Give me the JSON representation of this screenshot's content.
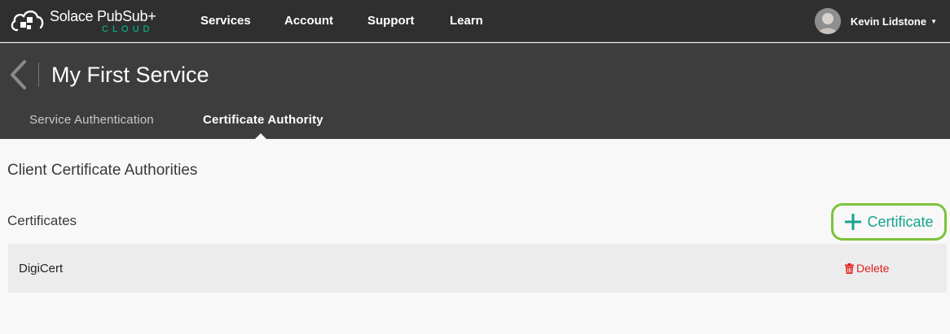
{
  "brand": {
    "name": "Solace PubSub+",
    "sub": "CLOUD",
    "logo_icon": "solace-cloud-logo-icon"
  },
  "nav": {
    "items": [
      {
        "label": "Services"
      },
      {
        "label": "Account"
      },
      {
        "label": "Support"
      },
      {
        "label": "Learn"
      }
    ],
    "user": {
      "name": "Kevin Lidstone",
      "avatar_icon": "user-avatar-icon",
      "caret_icon": "caret-down-icon"
    }
  },
  "service": {
    "title": "My First Service",
    "back_icon": "chevron-left-icon",
    "tabs": [
      {
        "label": "Service Authentication",
        "active": false
      },
      {
        "label": "Certificate Authority",
        "active": true
      }
    ]
  },
  "content": {
    "section_title": "Client Certificate Authorities",
    "certificates_title": "Certificates",
    "add_button": {
      "label": "Certificate",
      "icon": "plus-icon"
    },
    "certificates": [
      {
        "name": "DigiCert",
        "delete_label": "Delete",
        "delete_icon": "trash-icon"
      }
    ]
  },
  "colors": {
    "topnav_bg": "#2f2f2f",
    "header_bg": "#3d3d3d",
    "accent_teal": "#16a28e",
    "highlight_green": "#7cc33a",
    "delete_red": "#e0211b",
    "brand_green": "#00c895"
  }
}
